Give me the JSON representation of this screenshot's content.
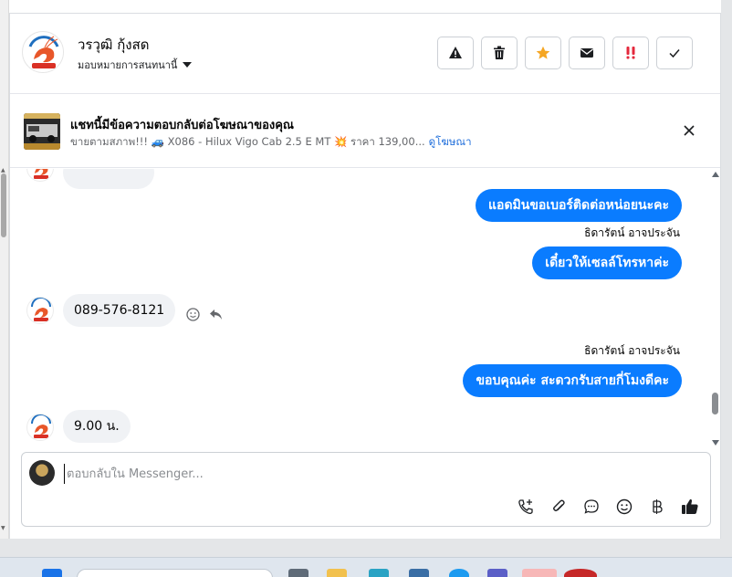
{
  "header": {
    "contact_name": "วรวุฒิ กุ้งสด",
    "assign_label": "มอบหมายการสนทนานี้",
    "actions": [
      {
        "name": "report-spam-button",
        "icon": "warning-icon"
      },
      {
        "name": "delete-button",
        "icon": "trash-icon"
      },
      {
        "name": "star-button",
        "icon": "star-icon",
        "color": "#f5a623"
      },
      {
        "name": "mark-unread-button",
        "icon": "envelope-icon"
      },
      {
        "name": "follow-up-button",
        "icon": "double-exclamation-icon",
        "color": "#e4283c"
      },
      {
        "name": "mark-done-button",
        "icon": "check-icon"
      }
    ]
  },
  "ad": {
    "title": "แชทนี้มีข้อความตอบกลับต่อโฆษณาของคุณ",
    "subtitle": "ขายตามสภาพ!!! 🚙 X086 - Hilux Vigo Cab 2.5 E MT 💥 ราคา 139,00...",
    "link": "ดูโฆษณา"
  },
  "messages": [
    {
      "direction": "out",
      "text": "แอดมินขอเบอร์ติดต่อหน่อยนะคะ"
    },
    {
      "direction": "out",
      "sender": "ธิดารัตน์ อาจประจัน",
      "text": "เดี๋ยวให้เซลล์โทรหาค่ะ"
    },
    {
      "direction": "in",
      "text": "089-576-8121"
    },
    {
      "direction": "out",
      "sender": "ธิดารัตน์ อาจประจัน",
      "text": "ขอบคุณค่ะ สะดวกรับสายกี่โมงดีคะ"
    },
    {
      "direction": "in",
      "text": "9.00 น."
    }
  ],
  "composer": {
    "placeholder": "ตอบกลับใน Messenger...",
    "tools": [
      "call-icon",
      "attachment-icon",
      "saved-reply-icon",
      "emoji-icon",
      "baht-icon",
      "thumbs-up-icon"
    ]
  },
  "colors": {
    "accent": "#0a7cff",
    "incoming_bubble": "#f0f2f5",
    "link": "#216fdb"
  }
}
